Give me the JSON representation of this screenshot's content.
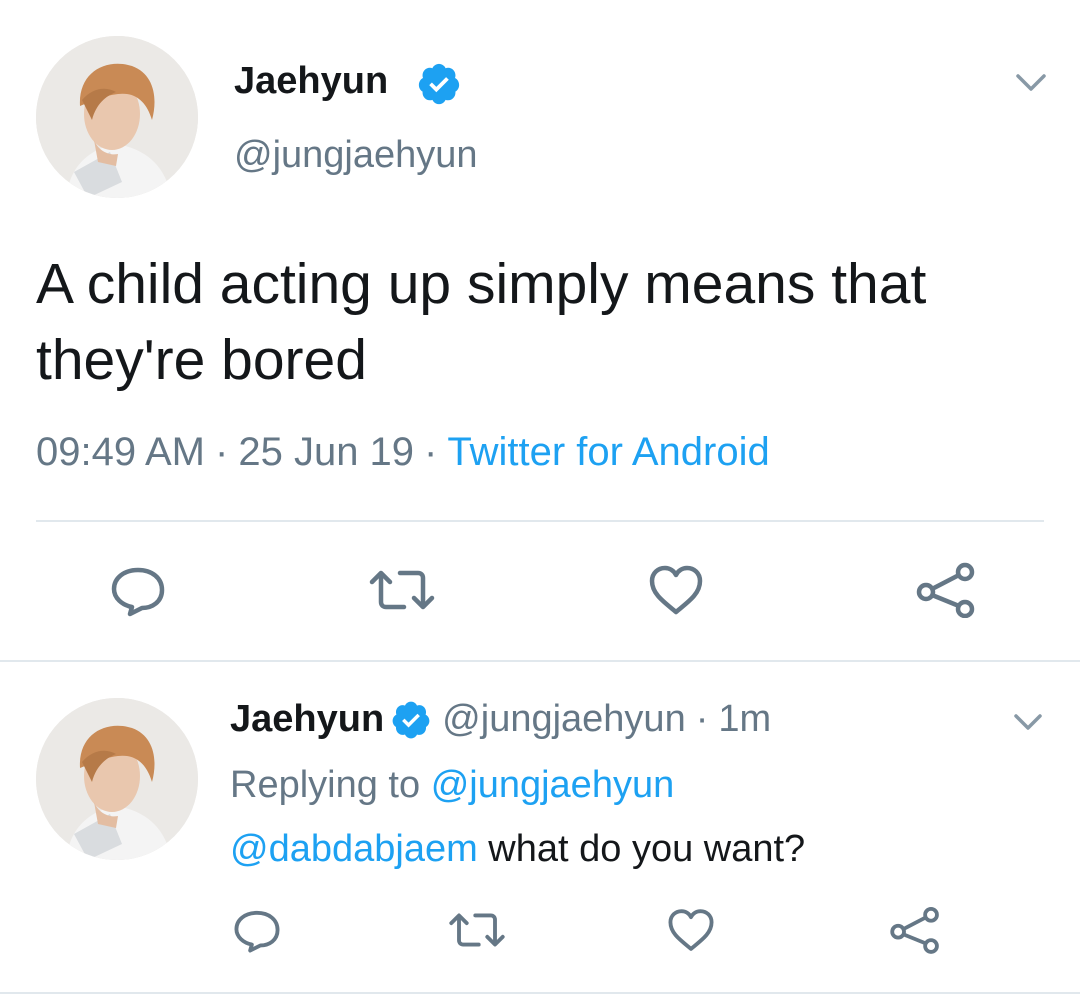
{
  "colors": {
    "text_primary": "#14171a",
    "text_secondary": "#657786",
    "link_blue": "#1da1f2",
    "icon_gray": "#657786",
    "divider": "#e1e8ed"
  },
  "main_tweet": {
    "author": {
      "display_name": "Jaehyun",
      "handle": "@jungjaehyun",
      "verified": true,
      "avatar_icon": "profile-photo"
    },
    "text": "A child acting up simply means that they're bored",
    "time": "09:49 AM",
    "separator": "·",
    "date": "25 Jun 19",
    "source": "Twitter for Android",
    "actions": {
      "reply_icon": "speech-bubble-icon",
      "retweet_icon": "retweet-icon",
      "like_icon": "heart-icon",
      "share_icon": "share-icon"
    }
  },
  "reply_tweet": {
    "author": {
      "display_name": "Jaehyun",
      "handle": "@jungjaehyun",
      "verified": true,
      "avatar_icon": "profile-photo"
    },
    "separator": "·",
    "time_ago": "1m",
    "replying_to_label": "Replying to",
    "replying_to_handle": "@jungjaehyun",
    "mention": "@dabdabjaem",
    "text": " what do you want?",
    "actions": {
      "reply_icon": "speech-bubble-icon",
      "retweet_icon": "retweet-icon",
      "like_icon": "heart-icon",
      "share_icon": "share-icon"
    }
  }
}
